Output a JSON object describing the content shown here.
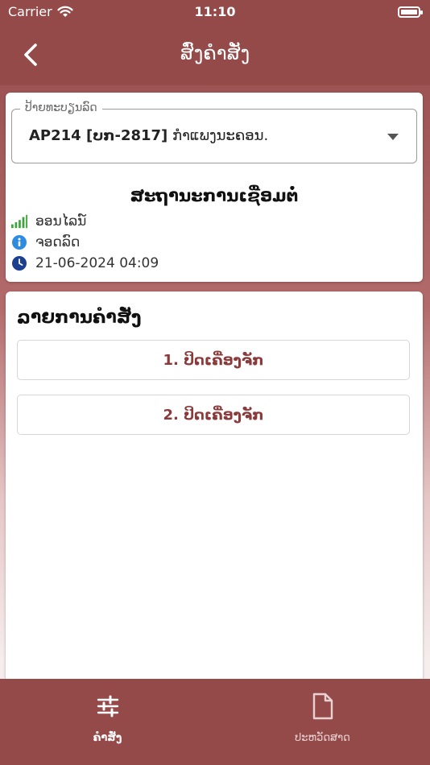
{
  "status_bar": {
    "carrier": "Carrier",
    "time": "11:10"
  },
  "nav": {
    "title": "ສົ່ງຄຳສັ່ງ",
    "back_icon": "chevron-left-icon"
  },
  "vehicle_select": {
    "legend": "ປ້າຍທະບຽນລົດ",
    "plate_code": "AP214 [ບກ-2817]",
    "location": "ກຳແພງນະຄອນ."
  },
  "connection": {
    "title": "ສະຖານະການເຊື່ອມຕໍ່",
    "status": "ອອນໄລນ໌",
    "ignition": "ຈອດລົດ",
    "datetime": "21-06-2024 04:09",
    "colors": {
      "signal": "#3aa63a",
      "info": "#2f8be0",
      "clock": "#1d3f8f"
    }
  },
  "commands": {
    "title": "ລາຍການຄຳສັ່ງ",
    "items": [
      {
        "label": "1. ປິດເຄື່ອງຈັກ"
      },
      {
        "label": "2. ປິດເຄື່ອງຈັກ"
      }
    ]
  },
  "tabs": [
    {
      "label": "ຄຳສັ່ງ",
      "icon": "sliders-icon",
      "active": true
    },
    {
      "label": "ປະຫວັດສາດ",
      "icon": "document-icon",
      "active": false
    }
  ],
  "colors": {
    "primary": "#954a4a",
    "button_text": "#8a3a3a"
  }
}
